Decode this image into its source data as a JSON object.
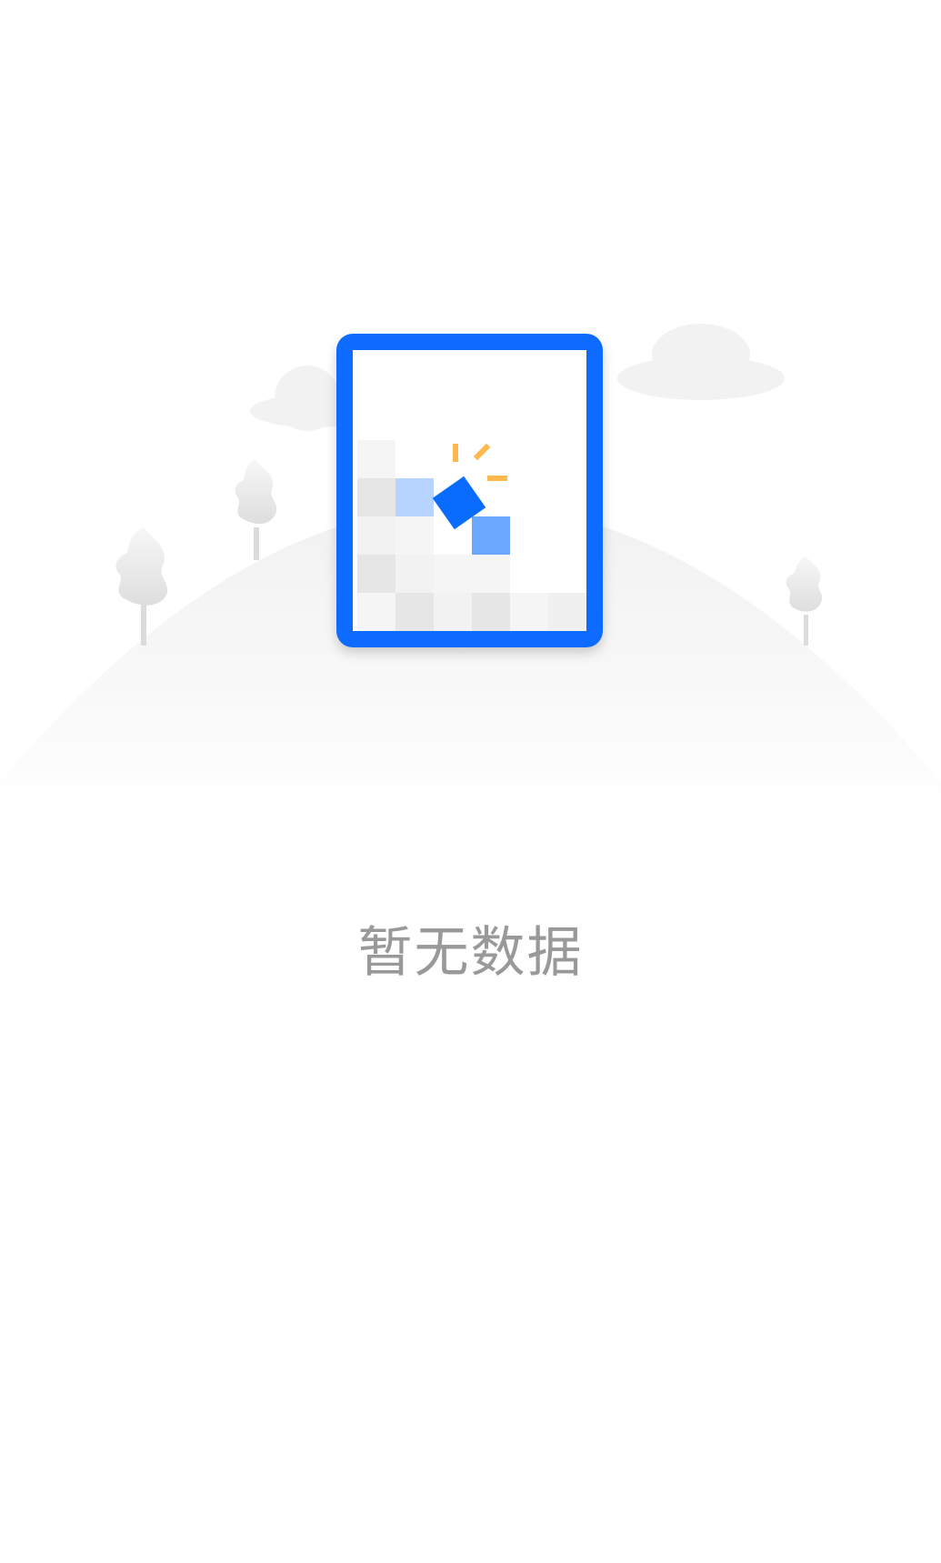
{
  "empty_state": {
    "message": "暂无数据",
    "accent_color": "#0A6CFF",
    "text_color": "#999999",
    "icons": [
      "empty-document-icon",
      "cloud-icon",
      "tree-icon"
    ]
  }
}
